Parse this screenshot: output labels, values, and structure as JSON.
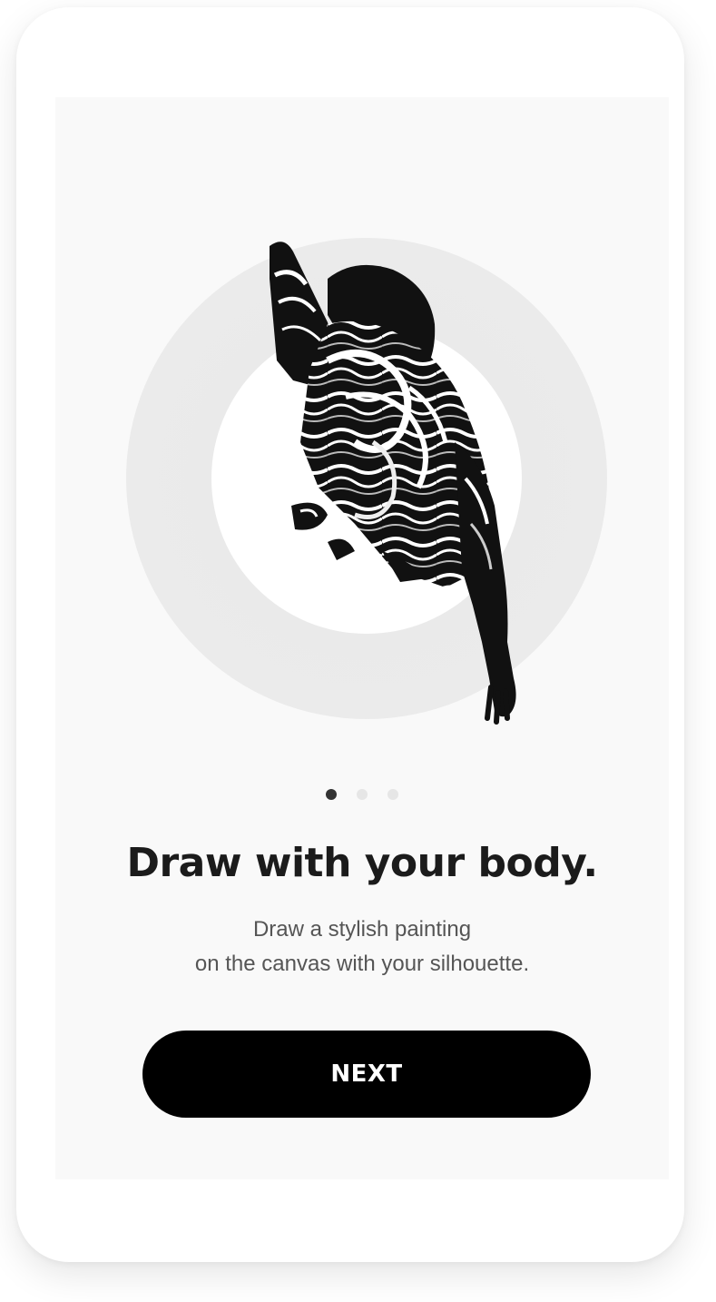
{
  "onboarding": {
    "title": "Draw with your body.",
    "subtitle_line1": "Draw a stylish painting",
    "subtitle_line2": "on the canvas with your silhouette.",
    "next_label": "NEXT",
    "current_page": 1,
    "total_pages": 3
  },
  "colors": {
    "accent": "#000000",
    "text": "#1b1b1b",
    "muted": "#555555",
    "dot_active": "#333333",
    "dot_inactive": "#e6e6e6"
  },
  "hero": {
    "illustration": "marbled-silhouette-figure"
  }
}
